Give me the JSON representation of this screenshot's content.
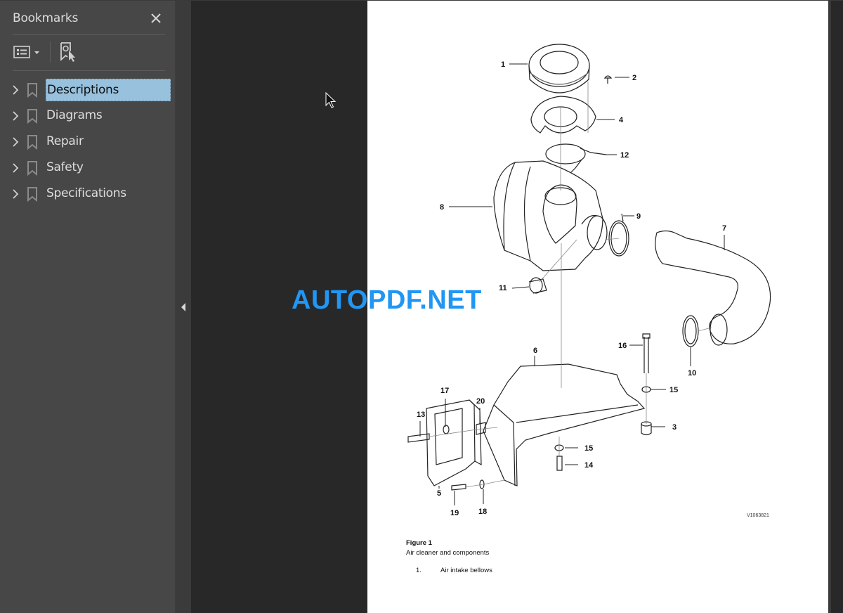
{
  "sidebar": {
    "title": "Bookmarks",
    "close_icon": "close-icon",
    "toolbar": {
      "options_icon": "list-options-icon",
      "dropdown_icon": "caret-down-icon",
      "find_bookmark_icon": "bookmark-find-icon"
    },
    "items": [
      {
        "label": "Descriptions",
        "selected": true,
        "icon": "bookmark-icon",
        "expand_icon": "chevron-right-icon"
      },
      {
        "label": "Diagrams",
        "selected": false,
        "icon": "bookmark-icon",
        "expand_icon": "chevron-right-icon"
      },
      {
        "label": "Repair",
        "selected": false,
        "icon": "bookmark-icon",
        "expand_icon": "chevron-right-icon"
      },
      {
        "label": "Safety",
        "selected": false,
        "icon": "bookmark-icon",
        "expand_icon": "chevron-right-icon"
      },
      {
        "label": "Specifications",
        "selected": false,
        "icon": "bookmark-icon",
        "expand_icon": "chevron-right-icon"
      }
    ],
    "collapse_icon": "triangle-left-icon"
  },
  "document": {
    "figure_ref": "V1063821",
    "callouts": [
      "1",
      "2",
      "4",
      "12",
      "8",
      "9",
      "7",
      "11",
      "16",
      "10",
      "6",
      "15",
      "17",
      "20",
      "13",
      "3",
      "15",
      "14",
      "5",
      "19",
      "18"
    ],
    "caption": {
      "title": "Figure 1",
      "subtitle": "Air cleaner and components",
      "items": [
        {
          "number": "1.",
          "text": "Air intake bellows"
        }
      ]
    }
  },
  "watermark": "AUTOPDF.NET",
  "colors": {
    "sidebar_bg": "#474747",
    "viewer_bg": "#282828",
    "selection": "#97c1dd",
    "watermark": "#2196f3"
  }
}
